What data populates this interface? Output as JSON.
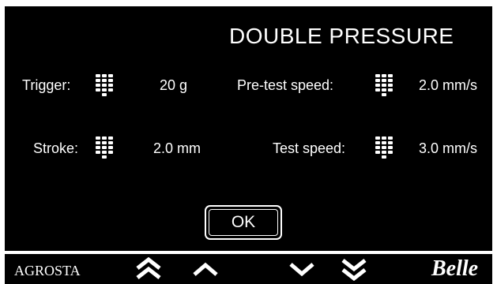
{
  "screen": {
    "title": "DOUBLE PRESSURE",
    "fields": {
      "trigger": {
        "label": "Trigger:",
        "value": "20 g"
      },
      "stroke": {
        "label": "Stroke:",
        "value": "2.0 mm"
      },
      "pretest_speed": {
        "label": "Pre-test speed:",
        "value": "2.0 mm/s"
      },
      "test_speed": {
        "label": "Test speed:",
        "value": "3.0 mm/s"
      }
    },
    "ok_label": "OK"
  },
  "footer": {
    "brand": "AGROSTA",
    "logo": "Belle",
    "icons": [
      "keypad-icon",
      "double-chevron-up-icon",
      "chevron-up-icon",
      "chevron-down-icon",
      "double-chevron-down-icon"
    ]
  },
  "colors": {
    "background": "#000000",
    "foreground": "#ffffff"
  }
}
